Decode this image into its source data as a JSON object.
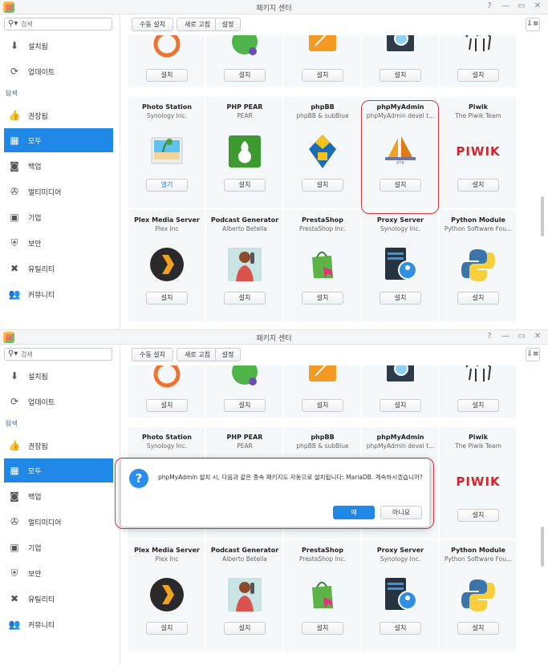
{
  "window": {
    "title": "패키지 센터",
    "controls": [
      "?",
      "—",
      "▭",
      "✕"
    ]
  },
  "sidebar": {
    "search_placeholder": "검색",
    "items_top": [
      {
        "label": "설치됨",
        "icon": "download-icon"
      },
      {
        "label": "업데이트",
        "icon": "refresh-icon"
      }
    ],
    "section_label": "탐색",
    "items_browse": [
      {
        "label": "권장됨",
        "icon": "thumbs-up-icon"
      },
      {
        "label": "모두",
        "icon": "grid-icon",
        "active": true
      },
      {
        "label": "백업",
        "icon": "backup-icon"
      },
      {
        "label": "멀티미디어",
        "icon": "film-reel-icon"
      },
      {
        "label": "기업",
        "icon": "briefcase-icon"
      },
      {
        "label": "보안",
        "icon": "shield-icon"
      },
      {
        "label": "유틸리티",
        "icon": "tools-icon"
      },
      {
        "label": "커뮤니티",
        "icon": "people-icon"
      }
    ]
  },
  "toolbar": {
    "manual_install": "수동 설치",
    "refresh": "새로 고침",
    "settings": "설정",
    "sort_icon": "sort-icon"
  },
  "packages": {
    "row0": [
      {
        "name": "",
        "publisher": "",
        "button": "설치",
        "icon": "orange-ring-icon"
      },
      {
        "name": "",
        "publisher": "",
        "button": "설치",
        "icon": "green-ball-icon"
      },
      {
        "name": "",
        "publisher": "",
        "button": "설치",
        "icon": "orange-tile-icon"
      },
      {
        "name": "",
        "publisher": "",
        "button": "설치",
        "icon": "magnifier-icon"
      },
      {
        "name": "",
        "publisher": "",
        "button": "설치",
        "icon": "camel-icon"
      }
    ],
    "row1": [
      {
        "name": "Photo Station",
        "publisher": "Synology Inc.",
        "button": "열기",
        "icon": "photo-icon"
      },
      {
        "name": "PHP PEAR",
        "publisher": "PEAR",
        "button": "설치",
        "icon": "pear-icon"
      },
      {
        "name": "phpBB",
        "publisher": "phpBB & subBlue",
        "button": "설치",
        "icon": "phpbb-icon"
      },
      {
        "name": "phpMyAdmin",
        "publisher": "phpMyAdmin devel t...",
        "button": "설치",
        "icon": "phpmyadmin-icon"
      },
      {
        "name": "Piwik",
        "publisher": "The Piwik Team",
        "button": "설치",
        "icon": "piwik-logo",
        "logo_text": "PIWIK"
      }
    ],
    "row2": [
      {
        "name": "Plex Media Server",
        "publisher": "Plex Inc",
        "button": "설치",
        "icon": "plex-icon"
      },
      {
        "name": "Podcast Generator",
        "publisher": "Alberto Betella",
        "button": "설치",
        "icon": "podcast-icon"
      },
      {
        "name": "PrestaShop",
        "publisher": "PrestaShop Inc.",
        "button": "설치",
        "icon": "shopping-bag-icon"
      },
      {
        "name": "Proxy Server",
        "publisher": "Synology Inc.",
        "button": "설치",
        "icon": "proxy-icon"
      },
      {
        "name": "Python Module",
        "publisher": "Python Software Fou...",
        "button": "설치",
        "icon": "python-icon"
      }
    ]
  },
  "dialog": {
    "icon": "question-icon",
    "message": "phpMyAdmin 설치 시, 다음과 같은 종속 패키지도 자동으로 설치됩니다: MariaDB. 계속하시겠습니까?",
    "yes": "예",
    "no": "아니요"
  },
  "colors": {
    "accent": "#1f87e6",
    "highlight": "#d8363a"
  }
}
